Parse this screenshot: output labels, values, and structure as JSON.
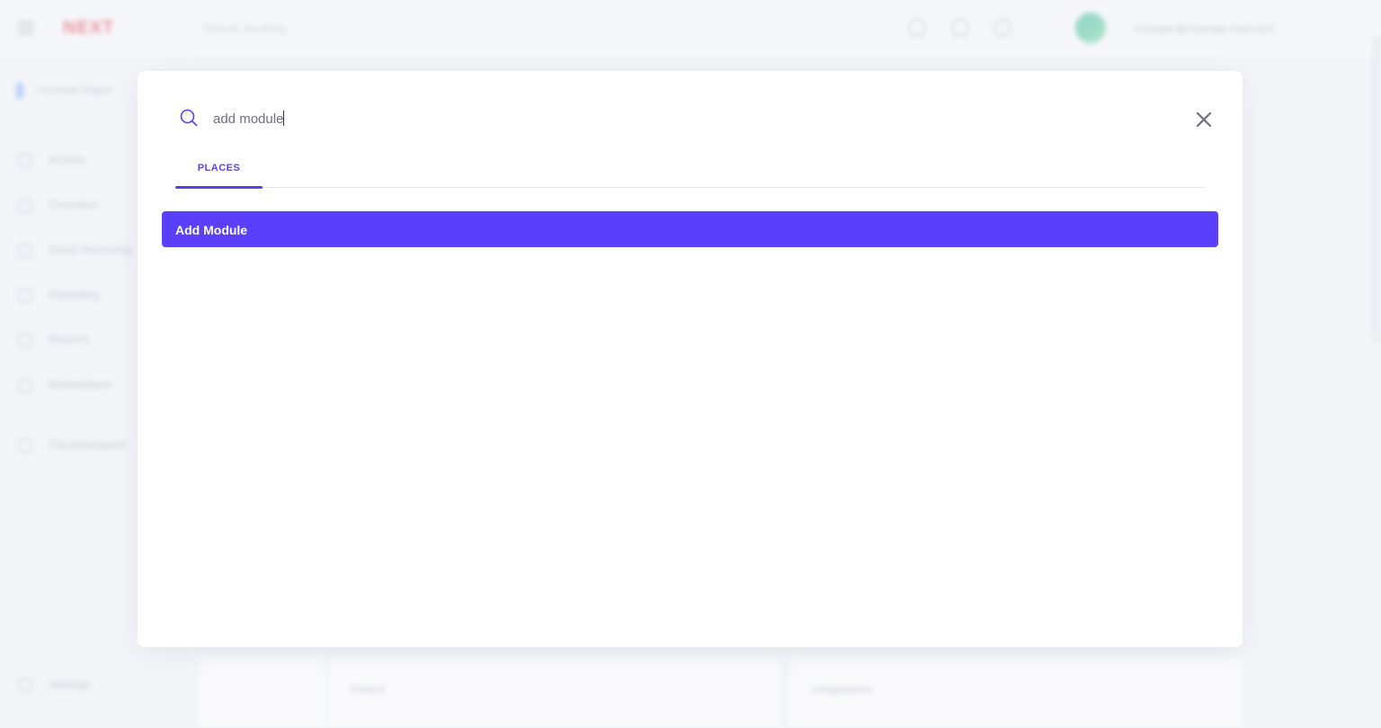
{
  "background": {
    "logo_text": "NEXT",
    "search_placeholder": "Search anything",
    "user_email": "example@example-mail.com",
    "sidebar_head": "Cromnet Digital",
    "sidebar_items": [
      "Activity",
      "Overview",
      "Stock Receiving",
      "Reporting",
      "Returns",
      "Marketplace",
      "Documentation",
      "Settings"
    ],
    "cards": [
      "Orders",
      "Integrations"
    ]
  },
  "modal": {
    "search": {
      "value": "add module",
      "icon": "search-icon"
    },
    "close_icon": "close-icon",
    "tabs": [
      {
        "label": "PLACES",
        "active": true
      }
    ],
    "results": [
      {
        "label": "Add Module",
        "highlighted": true
      }
    ]
  },
  "colors": {
    "accent": "#5a40fa",
    "tab_accent": "#5a3ff0",
    "modal_bg": "#ffffff",
    "page_bg": "#f4f5f9"
  }
}
